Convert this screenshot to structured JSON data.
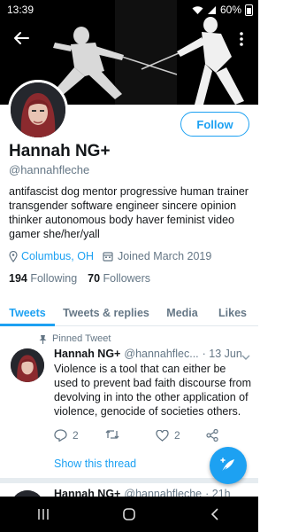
{
  "status_bar": {
    "time": "13:39",
    "battery": "60%"
  },
  "profile": {
    "name": "Hannah NG+",
    "handle": "@hannahfleche",
    "bio": "antifascist dog mentor progressive human trainer transgender software engineer sincere opinion thinker autonomous body haver feminist video gamer she/her/yall",
    "location": "Columbus, OH",
    "joined": "Joined March 2019",
    "following_count": "194",
    "following_label": "Following",
    "followers_count": "70",
    "followers_label": "Followers",
    "follow_label": "Follow"
  },
  "tabs": [
    {
      "label": "Tweets",
      "active": true
    },
    {
      "label": "Tweets & replies",
      "active": false
    },
    {
      "label": "Media",
      "active": false
    },
    {
      "label": "Likes",
      "active": false
    }
  ],
  "pinned_tweet": {
    "pinned_label": "Pinned Tweet",
    "author": "Hannah NG+",
    "handle_truncated": "@hannahflec...",
    "date": "· 13 Jun",
    "text": "Violence is a tool that can either be used to prevent bad faith discourse from devolving in into the other application of violence, genocide of societies others.",
    "reply_count": "2",
    "like_count": "2",
    "show_thread": "Show this thread"
  },
  "second_tweet": {
    "author": "Hannah NG+",
    "handle": "@hannahfleche",
    "time": "· 21h"
  },
  "icons": {
    "back": "arrow-left-icon",
    "more": "more-vertical-icon",
    "location": "location-pin-icon",
    "calendar": "calendar-icon",
    "pin": "pin-icon",
    "reply": "reply-icon",
    "retweet": "retweet-icon",
    "like": "heart-icon",
    "share": "share-icon",
    "compose": "compose-tweet-icon"
  },
  "colors": {
    "accent": "#1da1f2",
    "text": "#14171a",
    "muted": "#657786",
    "divider": "#e6ecf0"
  }
}
